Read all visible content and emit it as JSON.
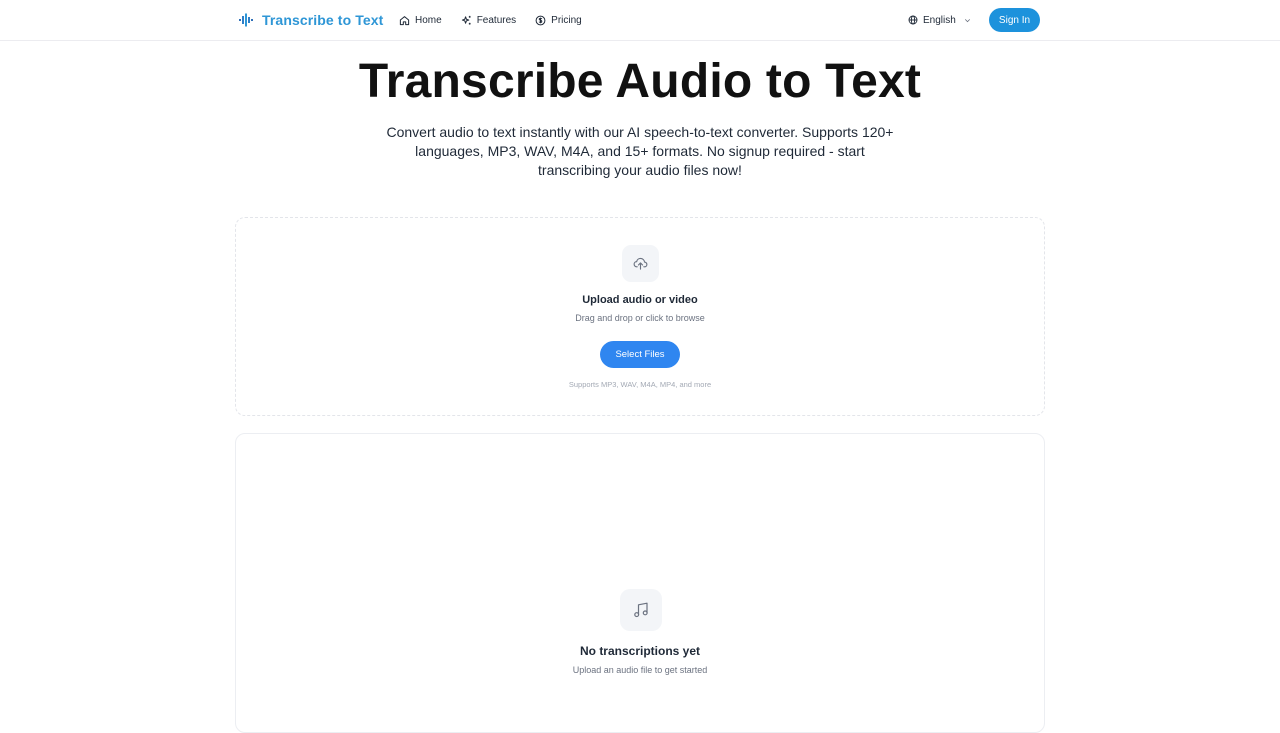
{
  "header": {
    "brand": "Transcribe to Text",
    "nav": [
      {
        "label": "Home",
        "icon": "home-icon"
      },
      {
        "label": "Features",
        "icon": "sparkles-icon"
      },
      {
        "label": "Pricing",
        "icon": "dollar-circle-icon"
      }
    ],
    "language": "English",
    "signin_label": "Sign In"
  },
  "hero": {
    "title": "Transcribe Audio to Text",
    "subtitle": "Convert audio to text instantly with our AI speech-to-text converter. Supports 120+ languages, MP3, WAV, M4A, and 15+ formats. No signup required - start transcribing your audio files now!"
  },
  "upload": {
    "icon": "cloud-upload-icon",
    "title": "Upload audio or video",
    "hint": "Drag and drop or click to browse",
    "button_label": "Select Files",
    "formats": "Supports MP3, WAV, M4A, MP4, and more"
  },
  "transcriptions": {
    "icon": "music-note-icon",
    "empty_title": "No transcriptions yet",
    "empty_hint": "Upload an audio file to get started"
  },
  "colors": {
    "brand": "#2e96d6",
    "signin": "#1d92dc",
    "primary_button": "#2f86f0"
  }
}
